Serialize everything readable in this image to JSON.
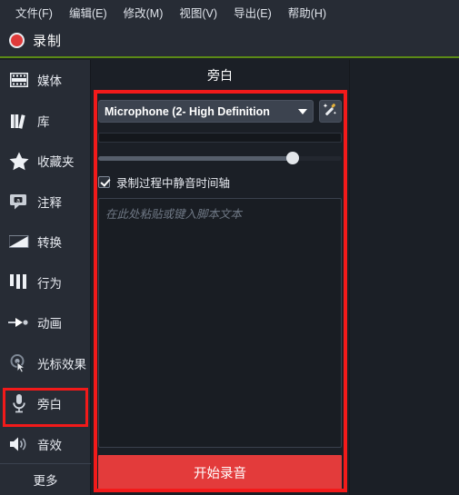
{
  "menubar": {
    "items": [
      {
        "label": "文件(F)",
        "name": "menu-file"
      },
      {
        "label": "编辑(E)",
        "name": "menu-edit"
      },
      {
        "label": "修改(M)",
        "name": "menu-modify"
      },
      {
        "label": "视图(V)",
        "name": "menu-view"
      },
      {
        "label": "导出(E)",
        "name": "menu-export"
      },
      {
        "label": "帮助(H)",
        "name": "menu-help"
      }
    ]
  },
  "toolbar": {
    "record_label": "录制",
    "record_icon": "record-dot-icon"
  },
  "sidebar": {
    "items": [
      {
        "label": "媒体",
        "icon": "film-strip-icon"
      },
      {
        "label": "库",
        "icon": "library-books-icon"
      },
      {
        "label": "收藏夹",
        "icon": "star-icon"
      },
      {
        "label": "注释",
        "icon": "callout-bubble-icon"
      },
      {
        "label": "转换",
        "icon": "transition-icon"
      },
      {
        "label": "行为",
        "icon": "behaviors-icon"
      },
      {
        "label": "动画",
        "icon": "animation-arrow-icon"
      },
      {
        "label": "光标效果",
        "icon": "cursor-effects-icon"
      },
      {
        "label": "旁白",
        "icon": "microphone-icon"
      },
      {
        "label": "音效",
        "icon": "speaker-icon"
      }
    ],
    "more_label": "更多",
    "active_index": 8
  },
  "panel": {
    "title": "旁白",
    "device": {
      "value": "Microphone (2- High Definition",
      "caret_icon": "chevron-down-icon",
      "wand_icon": "magic-wand-icon"
    },
    "level_meter": {
      "value": 0,
      "name": "input-level-meter"
    },
    "volume_slider": {
      "value": 80,
      "min": 0,
      "max": 100
    },
    "mute_checkbox": {
      "label": "录制过程中静音时间轴",
      "checked": true
    },
    "script": {
      "placeholder": "在此处粘贴或键入脚本文本",
      "value": ""
    },
    "start_button": {
      "label": "开始录音"
    }
  },
  "colors": {
    "accent_red": "#e33b3b",
    "highlight_red": "#f21a1a",
    "toolbar_bg": "#272c35",
    "panel_bg": "#1b1f26",
    "separator_green": "#5b8a16"
  }
}
